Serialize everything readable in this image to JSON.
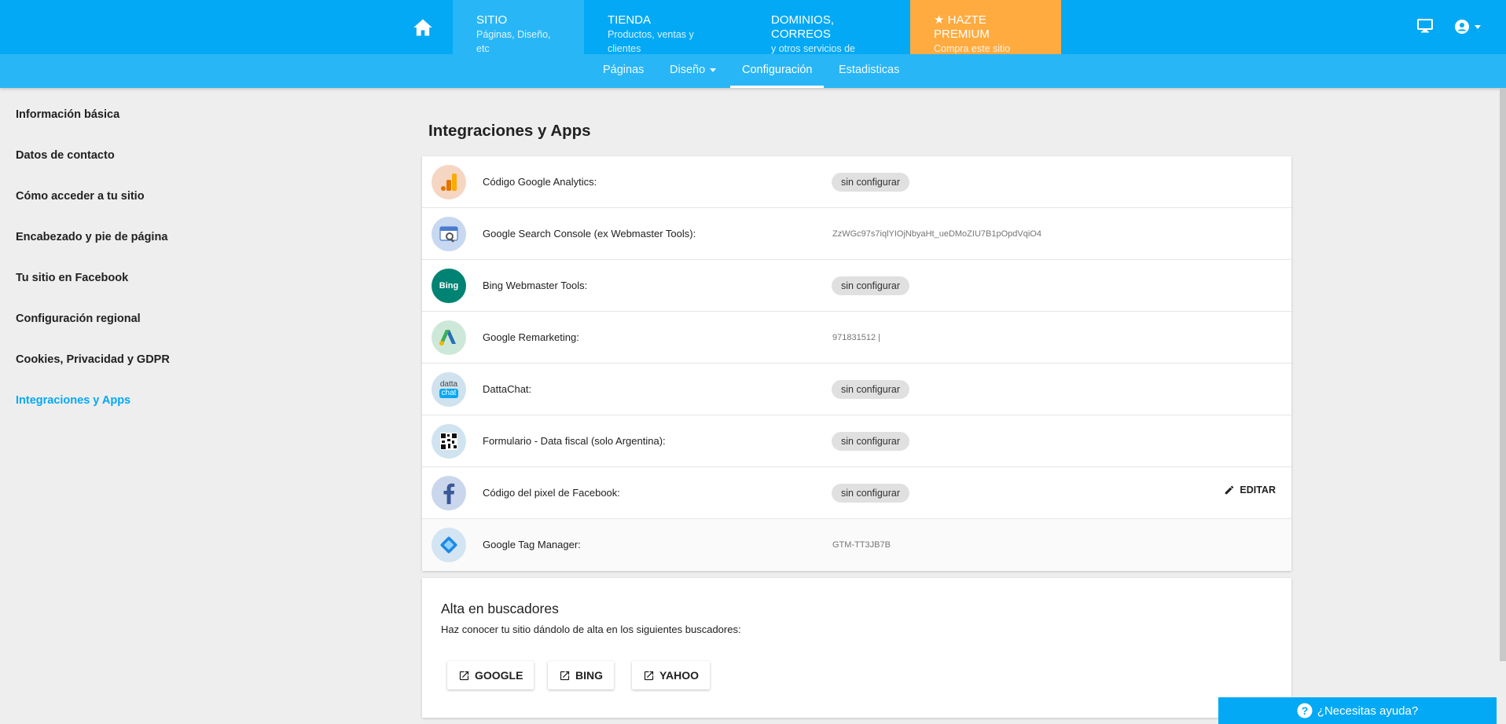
{
  "topnav": {
    "items": [
      {
        "title": "SITIO",
        "subtitle": "Páginas, Diseño, etc"
      },
      {
        "title": "TIENDA",
        "subtitle": "Productos, ventas y clientes"
      },
      {
        "title": "DOMINIOS, CORREOS",
        "subtitle": "y otros servicios de hosting"
      },
      {
        "title": "HAZTE PREMIUM",
        "subtitle": "Compra este sitio"
      }
    ],
    "colors": {
      "primary": "#03a9f4",
      "secondary": "#29b6f6",
      "premium": "#ffab40"
    }
  },
  "subnav": {
    "items": [
      "Páginas",
      "Diseño",
      "Configuración",
      "Estadisticas"
    ]
  },
  "sidebar": {
    "items": [
      "Información básica",
      "Datos de contacto",
      "Cómo acceder a tu sitio",
      "Encabezado y pie de página",
      "Tu sitio en Facebook",
      "Configuración regional",
      "Cookies, Privacidad y GDPR",
      "Integraciones y Apps"
    ]
  },
  "main": {
    "title": "Integraciones y Apps",
    "integrations": [
      {
        "label": "Código Google Analytics:",
        "value": "sin configurar",
        "icon": "google-analytics-icon"
      },
      {
        "label": "Google Search Console (ex Webmaster Tools):",
        "value": "ZzWGc97s7iqlYIOjNbyaHt_ueDMoZIU7B1pOpdVqiO4",
        "icon": "search-console-icon"
      },
      {
        "label": "Bing Webmaster Tools:",
        "value": "sin configurar",
        "icon": "bing-icon"
      },
      {
        "label": "Google Remarketing:",
        "value": "971831512 |",
        "icon": "google-ads-icon"
      },
      {
        "label": "DattaChat:",
        "value": "sin configurar",
        "icon": "dattachat-icon"
      },
      {
        "label": "Formulario - Data fiscal (solo Argentina):",
        "value": "sin configurar",
        "icon": "qr-code-icon"
      },
      {
        "label": "Código del pixel de Facebook:",
        "value": "sin configurar",
        "icon": "facebook-icon"
      },
      {
        "label": "Google Tag Manager:",
        "value": "GTM-TT3JB7B",
        "icon": "tag-manager-icon"
      }
    ],
    "edit_label": "EDITAR",
    "bing_text": "Bing",
    "datta_text": "datta",
    "chat_text": "chat"
  },
  "search_engines": {
    "title": "Alta en buscadores",
    "subtitle": "Haz conocer tu sitio dándolo de alta en los siguientes buscadores:",
    "buttons": [
      "GOOGLE",
      "BING",
      "YAHOO"
    ]
  },
  "help": {
    "label": "¿Necesitas ayuda?"
  }
}
